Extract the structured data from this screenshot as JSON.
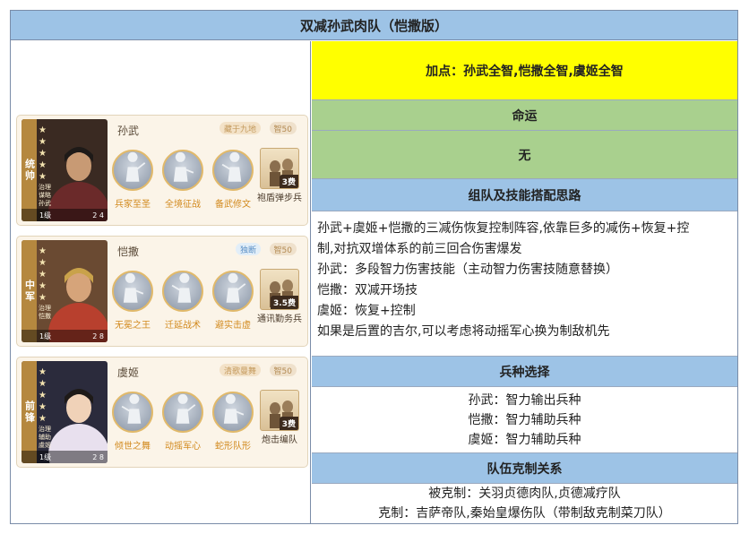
{
  "title": "双减孙武肉队（恺撒版）",
  "points": "加点：孙武全智,恺撒全智,虞姬全智",
  "fate_header": "命运",
  "fate_value": "无",
  "strategy_header": "组队及技能搭配思路",
  "strategy_lines": [
    "孙武+虞姬+恺撒的三减伤恢复控制阵容,依靠巨多的减伤+恢复+控",
    "制,对抗双增体系的前三回合伤害爆发",
    "孙武：多段智力伤害技能（主动智力伤害技随意替换）",
    "恺撒：双减开场技",
    "虞姬：恢复+控制",
    "如果是后置的吉尔,可以考虑将动摇军心换为制敌机先"
  ],
  "troop_header": "兵种选择",
  "troop_lines": [
    "孙武：智力输出兵种",
    "恺撒：智力辅助兵种",
    "虞姬：智力辅助兵种"
  ],
  "counter_header": "队伍克制关系",
  "counter_lines": [
    "被克制：关羽贞德肉队,贞德减疗队",
    "克制：吉萨帝队,秦始皇爆伤队（带制敌克制菜刀队）"
  ],
  "heroes": [
    {
      "position": "统帅",
      "name": "孙武",
      "tag": "藏于九地",
      "wis": "智50",
      "tags_text": [
        "治理",
        "谋略",
        "孙武"
      ],
      "level": "1级",
      "foot_right": "2  4",
      "skills": [
        "兵家至圣",
        "全境征战",
        "备武修文"
      ],
      "troop_name": "袍盾弹步兵",
      "troop_cost": "3费",
      "colors": {
        "cloak": "#6b2a2a",
        "skin": "#c89a74",
        "bg": "#3a2a22"
      }
    },
    {
      "position": "中军",
      "name": "恺撒",
      "tag": "独断",
      "wis": "智50",
      "tags_text": [
        "治理",
        "恺撒"
      ],
      "level": "1级",
      "foot_right": "2  8",
      "skills": [
        "无冕之王",
        "迁延战术",
        "避实击虚"
      ],
      "troop_name": "通讯勤务兵",
      "troop_cost": "3.5费",
      "colors": {
        "cloak": "#b8402e",
        "skin": "#d6a47a",
        "bg": "#6a4a32"
      }
    },
    {
      "position": "前锋",
      "name": "虞姬",
      "tag": "清歌曼舞",
      "wis": "智50",
      "tags_text": [
        "治理",
        "辅助",
        "虞姬"
      ],
      "level": "1级",
      "foot_right": "2  8",
      "skills": [
        "倾世之舞",
        "动摇军心",
        "蛇形队形"
      ],
      "troop_name": "炮击编队",
      "troop_cost": "3费",
      "colors": {
        "cloak": "#e8e0ee",
        "skin": "#f0d2b8",
        "bg": "#2b2b3c"
      }
    }
  ]
}
